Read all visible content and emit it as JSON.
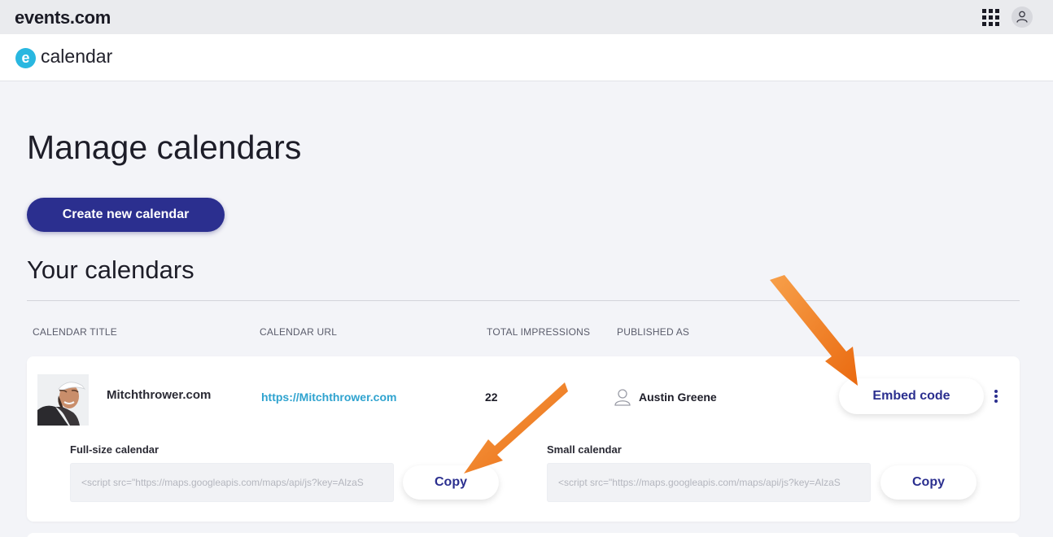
{
  "topbar": {
    "brand": "events.com",
    "apps_icon": "grid-apps-icon",
    "account_icon": "user-icon"
  },
  "appbar": {
    "logo_letter": "e",
    "app_name": "calendar"
  },
  "main": {
    "page_title": "Manage calendars",
    "create_button": "Create new calendar",
    "section_title": "Your calendars",
    "columns": [
      "CALENDAR TITLE",
      "CALENDAR URL",
      "TOTAL IMPRESSIONS",
      "PUBLISHED AS"
    ]
  },
  "calendar": {
    "title": "Mitchthrower.com",
    "url": "https://Mitchthrower.com",
    "impressions": "22",
    "published_as": "Austin Greene",
    "embed_button": "Embed code",
    "full_size_label": "Full-size calendar",
    "full_size_code": "<script src=\"https://maps.googleapis.com/maps/api/js?key=AlzaS",
    "small_label": "Small calendar",
    "small_code": "<script src=\"https://maps.googleapis.com/maps/api/js?key=AlzaS",
    "copy_label": "Copy"
  },
  "colors": {
    "accent": "#2b2f8f",
    "link": "#2fa3cf",
    "logo": "#29b7e0",
    "annotation_arrow": "#f07a1a"
  }
}
